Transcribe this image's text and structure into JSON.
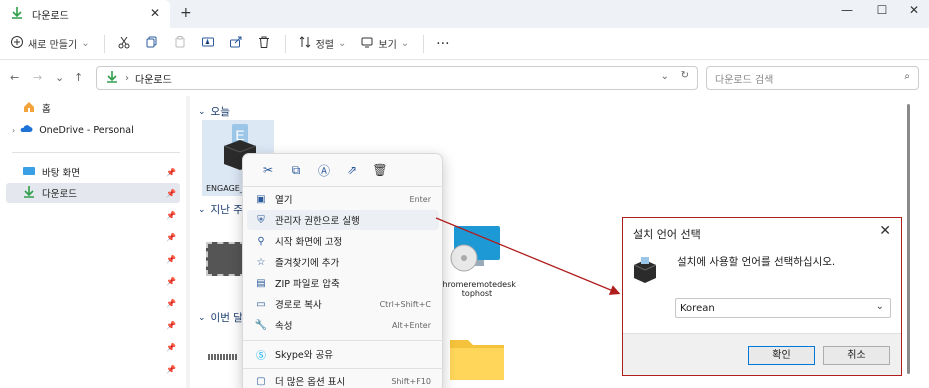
{
  "tab": {
    "title": "다운로드",
    "close": "✕",
    "new_tab": "+"
  },
  "window": {
    "minimize": "—",
    "maximize": "☐",
    "close": "✕"
  },
  "toolbar": {
    "new_label": "새로 만들기",
    "sort_label": "정렬",
    "view_label": "보기",
    "more": "···"
  },
  "address": {
    "path": "다운로드",
    "search_placeholder": "다운로드 검색"
  },
  "sidebar": {
    "items": [
      {
        "label": "홈",
        "icon": "home-icon"
      },
      {
        "label": "OneDrive - Personal",
        "icon": "cloud-icon"
      },
      {
        "label": "바탕 화면",
        "icon": "desktop-icon"
      },
      {
        "label": "다운로드",
        "icon": "download-icon"
      }
    ]
  },
  "content": {
    "groups": [
      {
        "label": "오늘"
      },
      {
        "label": "지난 주"
      },
      {
        "label": "이번 달"
      }
    ],
    "files": [
      {
        "name": "ENGAGE_"
      },
      {
        "name": "chromeremotedesktophost"
      }
    ]
  },
  "context_menu": {
    "items": [
      {
        "label": "열기",
        "shortcut": "Enter",
        "icon": "open-icon"
      },
      {
        "label": "관리자 권한으로 실행",
        "shortcut": "",
        "icon": "shield-icon"
      },
      {
        "label": "시작 화면에 고정",
        "shortcut": "",
        "icon": "pin-icon"
      },
      {
        "label": "즐겨찾기에 추가",
        "shortcut": "",
        "icon": "star-icon"
      },
      {
        "label": "ZIP 파일로 압축",
        "shortcut": "",
        "icon": "zip-icon"
      },
      {
        "label": "경로로 복사",
        "shortcut": "Ctrl+Shift+C",
        "icon": "path-icon"
      },
      {
        "label": "속성",
        "shortcut": "Alt+Enter",
        "icon": "wrench-icon"
      },
      {
        "label": "Skype와 공유",
        "shortcut": "",
        "icon": "skype-icon"
      },
      {
        "label": "더 많은 옵션 표시",
        "shortcut": "Shift+F10",
        "icon": "more-options-icon"
      }
    ]
  },
  "dialog": {
    "title": "설치 언어 선택",
    "message": "설치에 사용할 언어를 선택하십시오.",
    "selected_language": "Korean",
    "ok_label": "확인",
    "cancel_label": "취소"
  },
  "colors": {
    "arrow": "#b01d1d",
    "accent": "#0078d7"
  }
}
